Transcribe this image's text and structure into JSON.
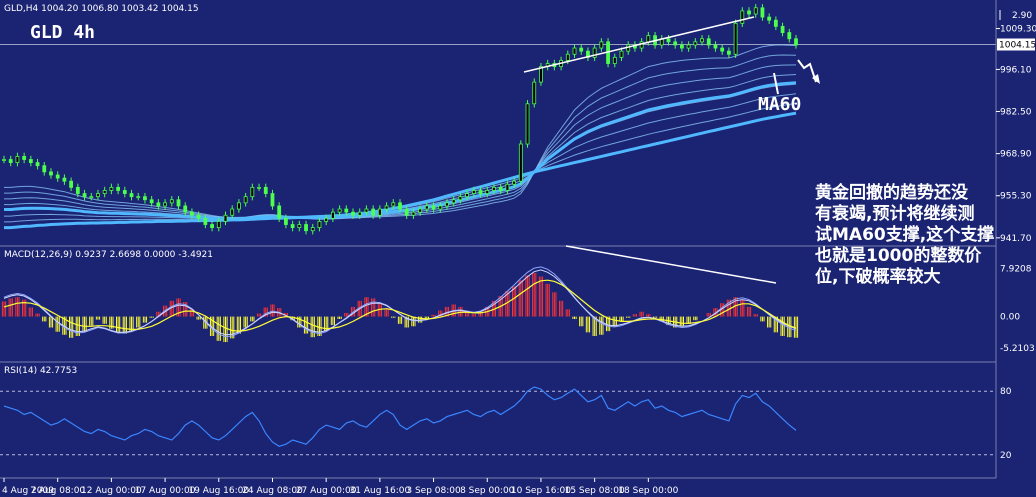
{
  "header": {
    "symbol_info": "GLD,H4  1004.20 1006.80 1003.42 1004.15",
    "chart_label": "GLD 4h",
    "macd_info": "MACD(12,26,9) 0.9237 2.6698 0.0000 -3.4921",
    "rsi_info": "RSI(14) 42.7753"
  },
  "annotations": {
    "ma60": "MA60",
    "comment_lines": [
      "黄金回撤的趋势还没",
      "有衰竭,预计将继续测",
      "试MA60支撑,这个支撑",
      "也就是1000的整数价",
      "位,下破概率较大"
    ]
  },
  "colors": {
    "background": "#1b2373",
    "candle": "#4cff4c",
    "ma_thick": "#4fb8ff",
    "ma_thin": "#8fd0ff",
    "macd_pos": "#ff3333",
    "macd_neg": "#ffff33",
    "signal": "#ffff33",
    "rsi": "#3a86ff",
    "grid": "#ffffff"
  },
  "chart_data": [
    {
      "type": "candlestick",
      "title": "GLD,H4",
      "y_ticks": [
        "1009.30",
        "996.10",
        "982.50",
        "968.90",
        "955.30",
        "941.70"
      ],
      "last_price": "1004.15",
      "top_label": "2.90",
      "ylim": [
        941,
        1014
      ],
      "x_ticks": [
        "4 Aug 2009",
        "7 Aug 08:00",
        "12 Aug 00:00",
        "17 Aug 00:00",
        "19 Aug 16:00",
        "24 Aug 08:00",
        "27 Aug 00:00",
        "31 Aug 16:00",
        "3 Sep 08:00",
        "8 Sep 00:00",
        "10 Sep 16:00",
        "15 Sep 08:00",
        "18 Sep 00:00"
      ],
      "closes": [
        967,
        966,
        968,
        967,
        966,
        965,
        963,
        962,
        961,
        960,
        958,
        956,
        955,
        955,
        956,
        957,
        958,
        957,
        956,
        955,
        955,
        954,
        953,
        952,
        953,
        954,
        952,
        950,
        949,
        948,
        946,
        945,
        947,
        949,
        951,
        953,
        955,
        958,
        958,
        956,
        952,
        948,
        946,
        945,
        946,
        944,
        945,
        947,
        948,
        950,
        951,
        950,
        949,
        950,
        951,
        949,
        951,
        952,
        953,
        951,
        949,
        950,
        951,
        952,
        951,
        952,
        953,
        954,
        955,
        956,
        957,
        956,
        957,
        958,
        957,
        959,
        960,
        972,
        985,
        992,
        997,
        998,
        997,
        999,
        1001,
        1003,
        1002,
        1000,
        1003,
        1005,
        998,
        1000,
        1002,
        1004,
        1003,
        1005,
        1007,
        1004,
        1006,
        1005,
        1004,
        1003,
        1004,
        1005,
        1006,
        1004,
        1003,
        1002,
        1001,
        1011,
        1015,
        1014,
        1016,
        1013,
        1012,
        1010,
        1008,
        1006,
        1004
      ],
      "ma60": [
        945,
        945,
        945.2,
        945.4,
        945.5,
        945.7,
        945.8,
        946,
        946.1,
        946.2,
        946.3,
        946.4,
        946.4,
        946.5,
        946.5,
        946.6,
        946.6,
        946.7,
        946.7,
        946.8,
        946.8,
        946.9,
        946.9,
        947,
        947,
        947,
        947.1,
        947.1,
        947.2,
        947.2,
        947.3,
        947.3,
        947.4,
        947.4,
        947.5,
        947.5,
        947.6,
        947.7,
        947.8,
        947.9,
        948,
        948,
        948.1,
        948.2,
        948.3,
        948.4,
        948.5,
        948.6,
        948.7,
        948.8,
        948.9,
        949.1,
        949.3,
        949.5,
        949.8,
        950.1,
        950.4,
        950.8,
        951.2,
        951.6,
        952,
        952.5,
        953,
        953.5,
        954,
        954.6,
        955.2,
        955.8,
        956.4,
        957,
        957.6,
        958.2,
        958.8,
        959.4,
        960,
        960.6,
        961.2,
        961.8,
        962.4,
        963,
        963.5,
        964,
        964.5,
        965,
        965.5,
        966,
        966.5,
        967,
        967.5,
        968,
        968.5,
        969,
        969.5,
        970,
        970.5,
        971,
        971.5,
        972,
        972.5,
        973,
        973.5,
        974,
        974.5,
        975,
        975.5,
        976,
        976.5,
        977,
        977.5,
        978,
        978.5,
        979,
        979.5,
        980,
        980.4,
        980.8,
        981.2,
        981.6,
        982
      ],
      "ma_fast": [
        958,
        958,
        958.2,
        958.3,
        958.3,
        958.1,
        957.8,
        957.4,
        957,
        956.6,
        956,
        955.4,
        954.8,
        954.3,
        953.9,
        953.6,
        953.4,
        953.2,
        953,
        952.8,
        952.6,
        952.4,
        952.1,
        951.8,
        951.5,
        951.2,
        950.9,
        950.5,
        950.1,
        949.7,
        949.3,
        948.9,
        948.6,
        948.4,
        948.3,
        948.3,
        948.4,
        948.7,
        949,
        949.2,
        949.2,
        949,
        948.7,
        948.4,
        948.2,
        948,
        947.8,
        947.7,
        947.7,
        947.8,
        947.9,
        948,
        948.1,
        948.2,
        948.3,
        948.4,
        948.5,
        948.6,
        948.7,
        948.8,
        948.9,
        949,
        949.2,
        949.4,
        949.6,
        949.9,
        950.2,
        950.5,
        950.9,
        951.3,
        951.7,
        952.1,
        952.5,
        953,
        953.4,
        953.9,
        954.5,
        956,
        959,
        963,
        967,
        971,
        974,
        977,
        980,
        983,
        985,
        987,
        988.5,
        990,
        991,
        992,
        993,
        994,
        995,
        996,
        997,
        997.5,
        998,
        998.4,
        998.7,
        999,
        999.2,
        999.4,
        999.6,
        999.7,
        999.8,
        999.8,
        999.8,
        1000.4,
        1001.2,
        1002,
        1002.8,
        1003.4,
        1003.8,
        1004,
        1004,
        1003.9,
        1003.8
      ],
      "x_tick_positions": [
        0,
        8,
        16,
        24,
        32,
        40,
        48,
        56,
        64,
        72,
        80,
        88,
        96
      ]
    },
    {
      "type": "bar",
      "title": "MACD(12,26,9)",
      "values": [
        0.9237,
        2.6698,
        0,
        -3.4921
      ],
      "y_ticks": [
        "7.9208",
        "0.00",
        "-5.2103"
      ],
      "ylim": [
        -6.5,
        9
      ],
      "histogram": [
        2.5,
        3.0,
        3.2,
        2.8,
        1.5,
        0.5,
        -0.8,
        -1.8,
        -2.5,
        -3.0,
        -3.5,
        -3.2,
        -2.5,
        -1.5,
        -0.5,
        -1.2,
        -2.0,
        -2.6,
        -2.8,
        -2.4,
        -1.8,
        -1.0,
        -0.2,
        0.8,
        1.8,
        2.6,
        3.0,
        2.4,
        1.2,
        -0.5,
        -2.0,
        -3.2,
        -4.0,
        -4.2,
        -3.6,
        -2.8,
        -1.8,
        -0.8,
        0.5,
        1.5,
        2.0,
        1.4,
        0.6,
        -0.6,
        -1.8,
        -2.8,
        -3.4,
        -3.2,
        -2.4,
        -1.4,
        -0.4,
        0.6,
        1.6,
        2.6,
        3.2,
        3.0,
        2.2,
        1.2,
        -0.2,
        -1.2,
        -1.8,
        -1.6,
        -1.0,
        -0.4,
        0.3,
        1.0,
        1.6,
        2.0,
        1.6,
        1.0,
        0.4,
        0.8,
        1.6,
        2.6,
        3.4,
        4.2,
        5.0,
        6.0,
        6.8,
        7.2,
        6.6,
        5.4,
        4.0,
        2.6,
        1.2,
        -0.4,
        -1.6,
        -2.6,
        -3.2,
        -3.0,
        -2.4,
        -1.6,
        -0.8,
        -0.2,
        0.4,
        0.8,
        0.4,
        -0.2,
        -0.8,
        -1.4,
        -1.8,
        -1.6,
        -1.2,
        -0.6,
        0,
        0.6,
        1.4,
        2.2,
        2.8,
        3.2,
        2.8,
        1.6,
        0.4,
        -0.8,
        -1.8,
        -2.6,
        -3.2,
        -3.4,
        -3.49
      ],
      "signal": [
        1.6,
        1.9,
        2.2,
        2.3,
        2.2,
        1.9,
        1.4,
        0.8,
        0.2,
        -0.4,
        -1.0,
        -1.4,
        -1.6,
        -1.6,
        -1.5,
        -1.5,
        -1.6,
        -1.8,
        -2.0,
        -2.1,
        -2.1,
        -1.9,
        -1.6,
        -1.1,
        -0.5,
        0.1,
        0.6,
        0.9,
        0.9,
        0.6,
        0.1,
        -0.6,
        -1.3,
        -1.9,
        -2.3,
        -2.4,
        -2.3,
        -2.0,
        -1.6,
        -1.1,
        -0.6,
        -0.2,
        0,
        -0.1,
        -0.4,
        -0.9,
        -1.4,
        -1.8,
        -2.0,
        -1.9,
        -1.7,
        -1.3,
        -0.8,
        -0.2,
        0.4,
        0.9,
        1.2,
        1.3,
        1.1,
        0.7,
        0.3,
        -0.1,
        -0.3,
        -0.4,
        -0.3,
        -0.1,
        0.2,
        0.5,
        0.7,
        0.7,
        0.6,
        0.6,
        0.8,
        1.2,
        1.7,
        2.3,
        3.0,
        3.8,
        4.6,
        5.4,
        5.9,
        6.0,
        5.8,
        5.3,
        4.6,
        3.7,
        2.8,
        1.9,
        1.0,
        0.3,
        -0.3,
        -0.6,
        -0.8,
        -0.8,
        -0.7,
        -0.5,
        -0.4,
        -0.4,
        -0.5,
        -0.7,
        -0.9,
        -1.1,
        -1.1,
        -1.0,
        -0.8,
        -0.5,
        0,
        0.6,
        1.2,
        1.8,
        2.1,
        2.1,
        1.8,
        1.2,
        0.5,
        -0.2,
        -0.9,
        -1.5,
        -1.9
      ],
      "macd_line": [
        3.0,
        3.4,
        3.6,
        3.4,
        2.8,
        2.0,
        1.0,
        0,
        -0.9,
        -1.6,
        -2.2,
        -2.5,
        -2.4,
        -2.0,
        -1.7,
        -1.9,
        -2.3,
        -2.6,
        -2.6,
        -2.4,
        -2.0,
        -1.5,
        -0.8,
        0,
        0.8,
        1.5,
        1.9,
        1.8,
        1.2,
        0.3,
        -0.8,
        -1.8,
        -2.6,
        -3.0,
        -2.9,
        -2.5,
        -1.9,
        -1.2,
        -0.4,
        0.3,
        0.7,
        0.6,
        0.2,
        -0.4,
        -1.2,
        -1.9,
        -2.4,
        -2.6,
        -2.3,
        -1.7,
        -1.0,
        -0.3,
        0.5,
        1.3,
        1.9,
        2.2,
        2.2,
        1.8,
        1.1,
        0.4,
        -0.3,
        -0.6,
        -0.6,
        -0.5,
        -0.2,
        0.2,
        0.6,
        0.9,
        1.0,
        0.8,
        0.6,
        0.8,
        1.3,
        2.0,
        2.8,
        3.7,
        4.6,
        5.6,
        6.6,
        7.4,
        7.7,
        7.3,
        6.6,
        5.6,
        4.4,
        3.1,
        1.9,
        0.8,
        -0.2,
        -0.9,
        -1.4,
        -1.5,
        -1.3,
        -1.0,
        -0.6,
        -0.2,
        -0.1,
        -0.3,
        -0.7,
        -1.1,
        -1.4,
        -1.6,
        -1.5,
        -1.2,
        -0.8,
        -0.2,
        0.5,
        1.3,
        2.0,
        2.6,
        2.8,
        2.6,
        2.0,
        1.2,
        0.4,
        -0.4,
        -1.1,
        -1.6,
        -2.0
      ],
      "macd_line_2": [
        3.2,
        3.6,
        3.8,
        3.6,
        3.0,
        2.2,
        1.2,
        0.1,
        -1.0,
        -1.8,
        -2.4,
        -2.7,
        -2.6,
        -2.2,
        -1.8,
        -2.0,
        -2.4,
        -2.7,
        -2.7,
        -2.5,
        -2.1,
        -1.5,
        -0.8,
        0.1,
        1.0,
        1.7,
        2.1,
        2.0,
        1.3,
        0.3,
        -0.9,
        -2.0,
        -2.9,
        -3.3,
        -3.2,
        -2.7,
        -2.0,
        -1.2,
        -0.3,
        0.5,
        0.9,
        0.7,
        0.2,
        -0.5,
        -1.3,
        -2.1,
        -2.6,
        -2.8,
        -2.5,
        -1.8,
        -1.0,
        -0.2,
        0.7,
        1.5,
        2.1,
        2.4,
        2.3,
        1.9,
        1.1,
        0.4,
        -0.4,
        -0.7,
        -0.7,
        -0.5,
        -0.2,
        0.3,
        0.7,
        1.0,
        1.1,
        0.9,
        0.7,
        0.9,
        1.5,
        2.3,
        3.2,
        4.2,
        5.2,
        6.3,
        7.3,
        8.0,
        8.2,
        7.8,
        7.0,
        5.9,
        4.6,
        3.2,
        1.9,
        0.7,
        -0.4,
        -1.1,
        -1.6,
        -1.7,
        -1.5,
        -1.1,
        -0.7,
        -0.3,
        -0.1,
        -0.4,
        -0.8,
        -1.3,
        -1.6,
        -1.8,
        -1.7,
        -1.3,
        -0.8,
        -0.2,
        0.6,
        1.5,
        2.3,
        2.9,
        3.1,
        2.8,
        2.1,
        1.2,
        0.3,
        -0.6,
        -1.3,
        -1.9,
        -2.3
      ]
    },
    {
      "type": "line",
      "title": "RSI(14)",
      "value": 42.7753,
      "y_ticks": [
        "80",
        "20"
      ],
      "ylim": [
        0,
        100
      ],
      "values": [
        66,
        64,
        62,
        58,
        60,
        56,
        52,
        48,
        50,
        54,
        50,
        46,
        42,
        40,
        44,
        42,
        38,
        36,
        34,
        38,
        40,
        44,
        42,
        38,
        36,
        34,
        40,
        48,
        52,
        48,
        42,
        36,
        34,
        38,
        44,
        50,
        56,
        60,
        52,
        40,
        32,
        28,
        30,
        34,
        32,
        30,
        36,
        44,
        48,
        46,
        44,
        50,
        52,
        48,
        46,
        52,
        58,
        62,
        58,
        48,
        44,
        48,
        52,
        54,
        50,
        52,
        56,
        58,
        60,
        62,
        58,
        56,
        60,
        62,
        58,
        62,
        66,
        72,
        80,
        84,
        82,
        76,
        72,
        74,
        78,
        82,
        76,
        70,
        72,
        76,
        64,
        62,
        66,
        70,
        66,
        70,
        72,
        64,
        66,
        62,
        60,
        56,
        58,
        60,
        62,
        58,
        56,
        54,
        52,
        68,
        76,
        74,
        78,
        70,
        66,
        60,
        54,
        48,
        43
      ]
    }
  ]
}
